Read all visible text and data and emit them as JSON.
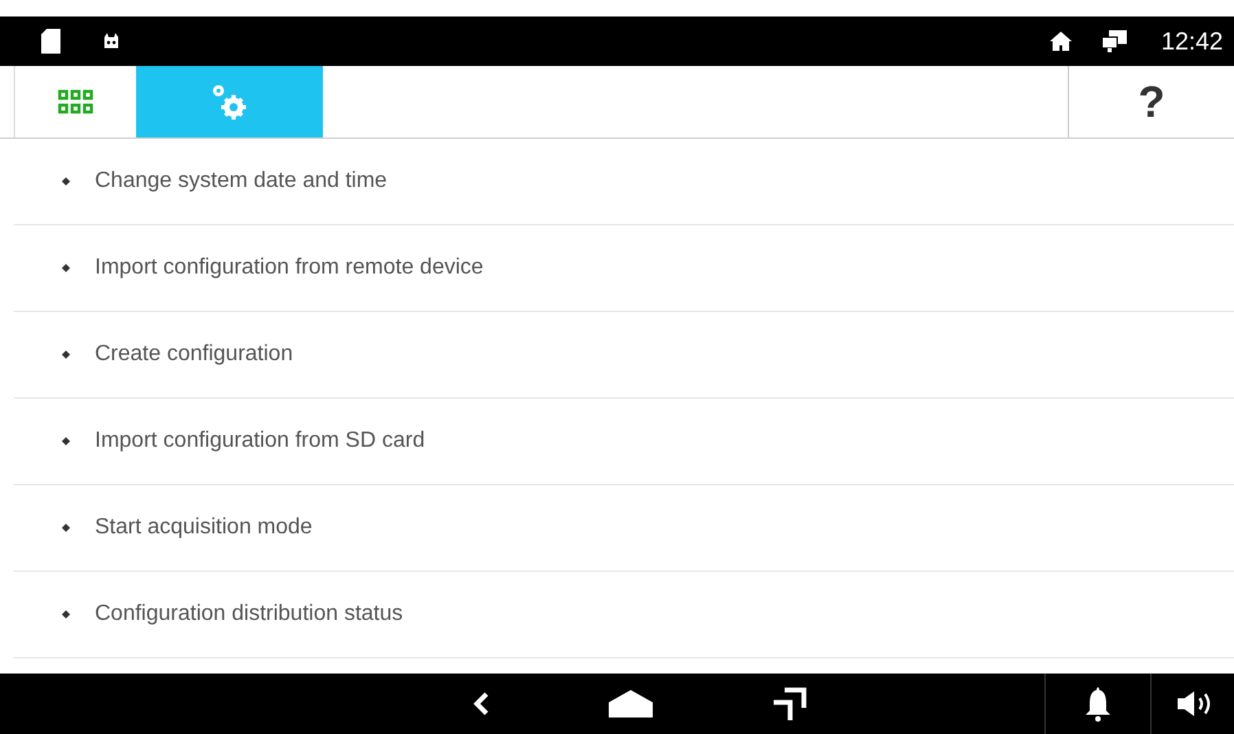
{
  "status_bar": {
    "time": "12:42"
  },
  "tabs": [
    {
      "kind": "apps",
      "selected": false
    },
    {
      "kind": "settings",
      "selected": true
    }
  ],
  "help": {
    "label": "?"
  },
  "menu": [
    {
      "label": "Change system date and time"
    },
    {
      "label": "Import configuration from remote device"
    },
    {
      "label": "Create configuration"
    },
    {
      "label": "Import configuration from SD card"
    },
    {
      "label": "Start acquisition mode"
    },
    {
      "label": "Configuration distribution status"
    }
  ]
}
